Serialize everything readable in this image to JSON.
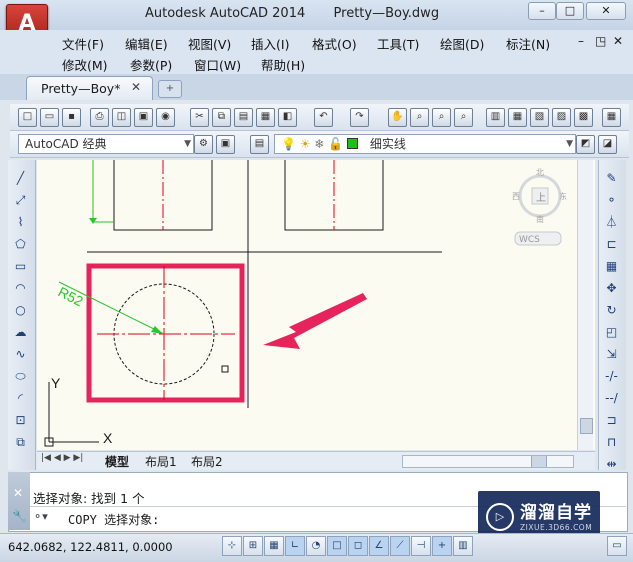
{
  "app": {
    "name": "Autodesk AutoCAD 2014",
    "filename": "Pretty—Boy.dwg",
    "app_button_glyph": "A",
    "accent": "#c0251c"
  },
  "window_controls": [
    "–",
    "□",
    "✕"
  ],
  "menu_row1": [
    "文件(F)",
    "编辑(E)",
    "视图(V)",
    "插入(I)",
    "格式(O)",
    "工具(T)",
    "绘图(D)",
    "标注(N)"
  ],
  "menu_row2": [
    "修改(M)",
    "参数(P)",
    "窗口(W)",
    "帮助(H)"
  ],
  "mdi_controls": [
    "–",
    "◳",
    "✕"
  ],
  "doc_tab": {
    "label": "Pretty—Boy*",
    "close": "✕"
  },
  "workspace": {
    "value": "AutoCAD 经典"
  },
  "layer": {
    "value": "细实线",
    "swatch_color": "#19c219"
  },
  "viewcube": {
    "north": "北",
    "south": "南",
    "east": "东",
    "west": "西",
    "top": "上",
    "wcs": "WCS"
  },
  "drawing": {
    "dimension_text": "R52",
    "axis_y": "Y",
    "axis_x": "X",
    "highlight_color": "#e6235a",
    "centerline_color": "#e0001a",
    "dim_color": "#29c629"
  },
  "layout_tabs": [
    "模型",
    "布局1",
    "布局2"
  ],
  "command": {
    "history_line": "选择对象: 找到 1 个",
    "prompt": "COPY 选择对象:"
  },
  "status": {
    "coordinates": "642.0682, 122.4811, 0.0000"
  },
  "watermark": {
    "name": "溜溜自学",
    "url": "ZIXUE.3D66.COM"
  }
}
